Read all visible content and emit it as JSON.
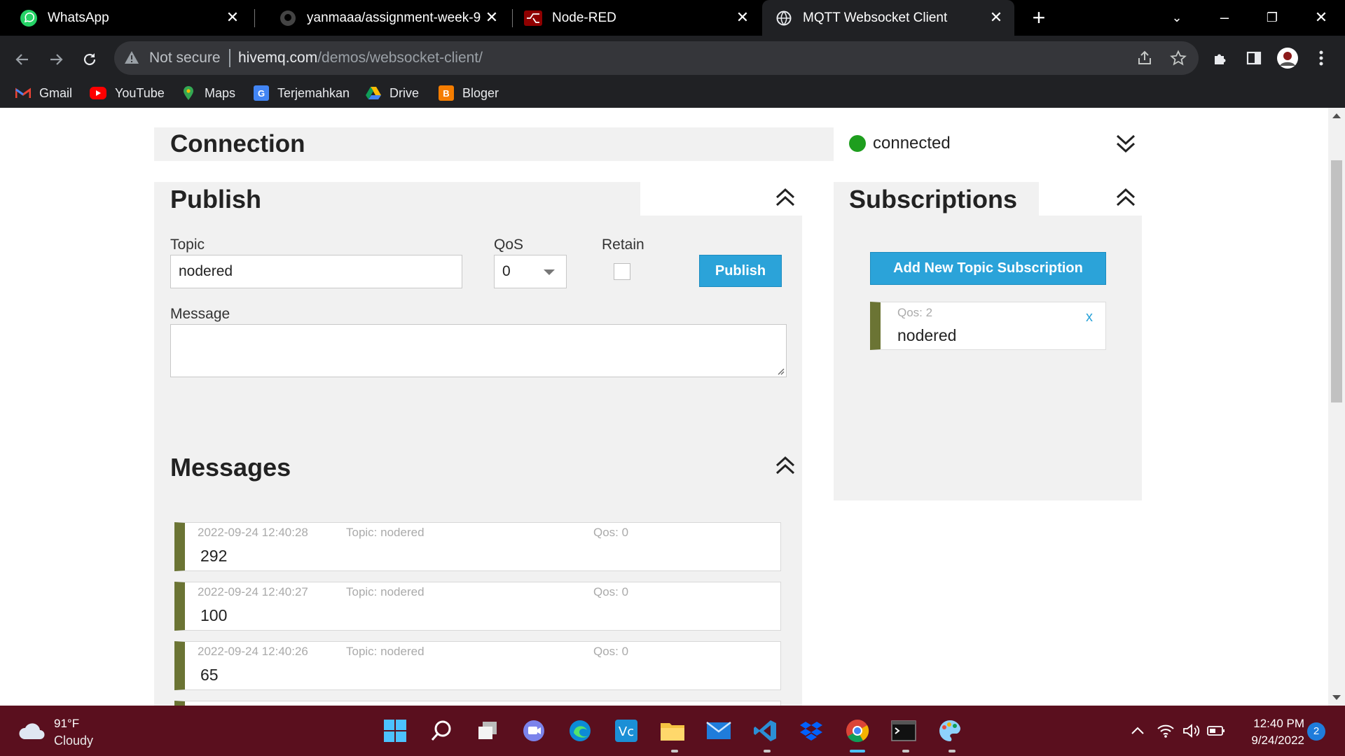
{
  "browser": {
    "tabs": [
      {
        "title": "WhatsApp",
        "icon": "whatsapp-icon"
      },
      {
        "title": "yanmaaa/assignment-week-9",
        "icon": "github-icon"
      },
      {
        "title": "Node-RED",
        "icon": "node-red-icon"
      },
      {
        "title": "MQTT Websocket Client",
        "icon": "globe-icon",
        "active": true
      }
    ],
    "security_label": "Not secure",
    "url_host": "hivemq.com",
    "url_path": "/demos/websocket-client/",
    "bookmarks": [
      {
        "label": "Gmail",
        "icon": "gmail-icon",
        "color": "#ea4335"
      },
      {
        "label": "YouTube",
        "icon": "youtube-icon",
        "color": "#ff0000"
      },
      {
        "label": "Maps",
        "icon": "maps-icon",
        "color": "#34a853"
      },
      {
        "label": "Terjemahkan",
        "icon": "translate-icon",
        "color": "#4285f4"
      },
      {
        "label": "Drive",
        "icon": "drive-icon",
        "color": "#fbbc04"
      },
      {
        "label": "Bloger",
        "icon": "blogger-icon",
        "color": "#f57d00"
      }
    ]
  },
  "connection": {
    "title": "Connection",
    "status": "connected",
    "status_color": "#1e9e1e"
  },
  "publish": {
    "title": "Publish",
    "topic_label": "Topic",
    "topic_value": "nodered",
    "qos_label": "QoS",
    "qos_value": "0",
    "retain_label": "Retain",
    "retain_checked": false,
    "button_label": "Publish",
    "message_label": "Message",
    "message_value": ""
  },
  "subscriptions": {
    "title": "Subscriptions",
    "add_button_label": "Add New Topic Subscription",
    "items": [
      {
        "qos": "Qos: 2",
        "topic": "nodered",
        "close": "x",
        "color": "#6b7434"
      }
    ]
  },
  "messages": {
    "title": "Messages",
    "items": [
      {
        "time": "2022-09-24 12:40:28",
        "topic": "Topic: nodered",
        "qos": "Qos: 0",
        "payload": "292"
      },
      {
        "time": "2022-09-24 12:40:27",
        "topic": "Topic: nodered",
        "qos": "Qos: 0",
        "payload": "100"
      },
      {
        "time": "2022-09-24 12:40:26",
        "topic": "Topic: nodered",
        "qos": "Qos: 0",
        "payload": "65"
      }
    ]
  },
  "taskbar": {
    "weather_temp": "91°F",
    "weather_desc": "Cloudy",
    "clock_time": "12:40 PM",
    "clock_date": "9/24/2022",
    "notification_count": "2",
    "accent_color": "#5a0f1e"
  }
}
